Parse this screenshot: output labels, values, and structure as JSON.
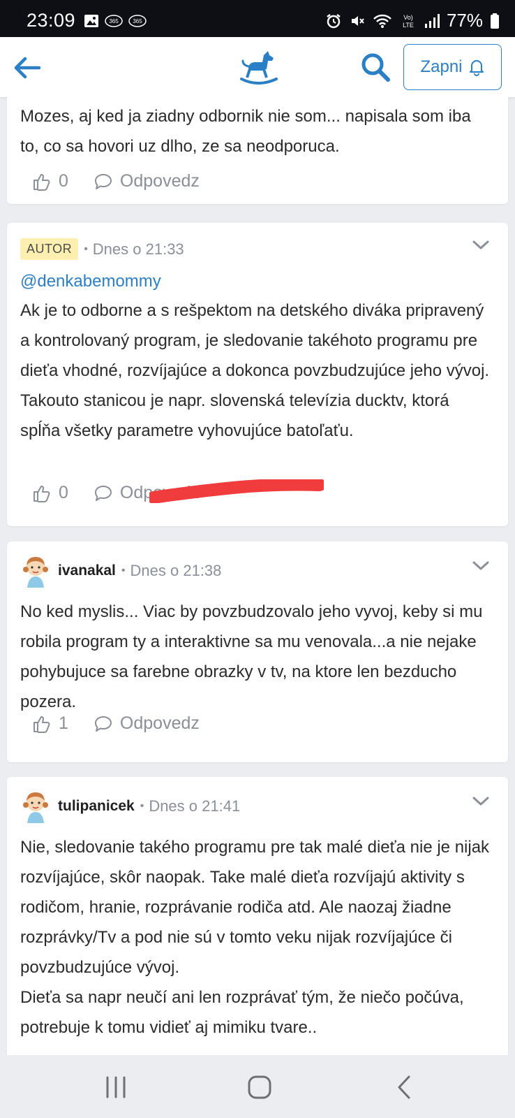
{
  "status_bar": {
    "time": "23:09",
    "battery": "77%",
    "icons": [
      "image-icon",
      "365-icon",
      "365-icon",
      "alarm-icon",
      "mute-icon",
      "wifi-icon",
      "volte-icon",
      "signal-icon",
      "battery-icon"
    ],
    "volte_label": "Vo) LTE"
  },
  "app_bar": {
    "notify_button_label": "Zapni",
    "accent": "#2b7fc4"
  },
  "comments": [
    {
      "body": "Mozes, aj ked ja ziadny odbornik nie som... napisala som iba to, co sa hovori uz dlho, ze sa neodporuca.",
      "likes": "0",
      "reply_label": "Odpovedz"
    },
    {
      "badge": "AUTOR",
      "time": "Dnes o 21:33",
      "mention": "@denkabemommy",
      "body": "Ak je to odborne a s rešpektom na detského diváka pripravený a kontrolovaný program, je sledovanie takéhoto programu pre dieťa vhodné, rozvíjajúce a dokonca povzbudzujúce jeho vývoj. Takouto stanicou je napr. slovenská televízia ducktv, ktorá spĺňa všetky parametre vyhovujúce batoľaťu.",
      "likes": "0",
      "reply_label": "Odpovedz"
    },
    {
      "username": "ivanakal",
      "time": "Dnes o 21:38",
      "body": "No ked myslis... Viac by povzbudzovalo jeho vyvoj, keby si mu robila program ty a interaktivne sa mu venovala...a nie nejake pohybujuce sa farebne obrazky v tv, na ktore len bezducho pozera.",
      "likes": "1",
      "reply_label": "Odpovedz"
    },
    {
      "username": "tulipanicek",
      "time": "Dnes o 21:41",
      "body": "Nie, sledovanie takého programu pre tak malé dieťa nie je nijak rozvíjajúce, skôr naopak. Take malé dieťa rozvíjajú aktivity s rodičom, hranie, rozprávanie rodiča atd. Ale naozaj žiadne rozprávky/Tv a pod nie sú v tomto veku nijak rozvíjajúce či povzbudzujúce vývoj.\nDieťa sa napr neučí ani len rozprávať tým, že niečo počúva, potrebuje k tomu vidieť aj mimiku tvare.."
    }
  ],
  "annotation_color": "#f03c3c"
}
